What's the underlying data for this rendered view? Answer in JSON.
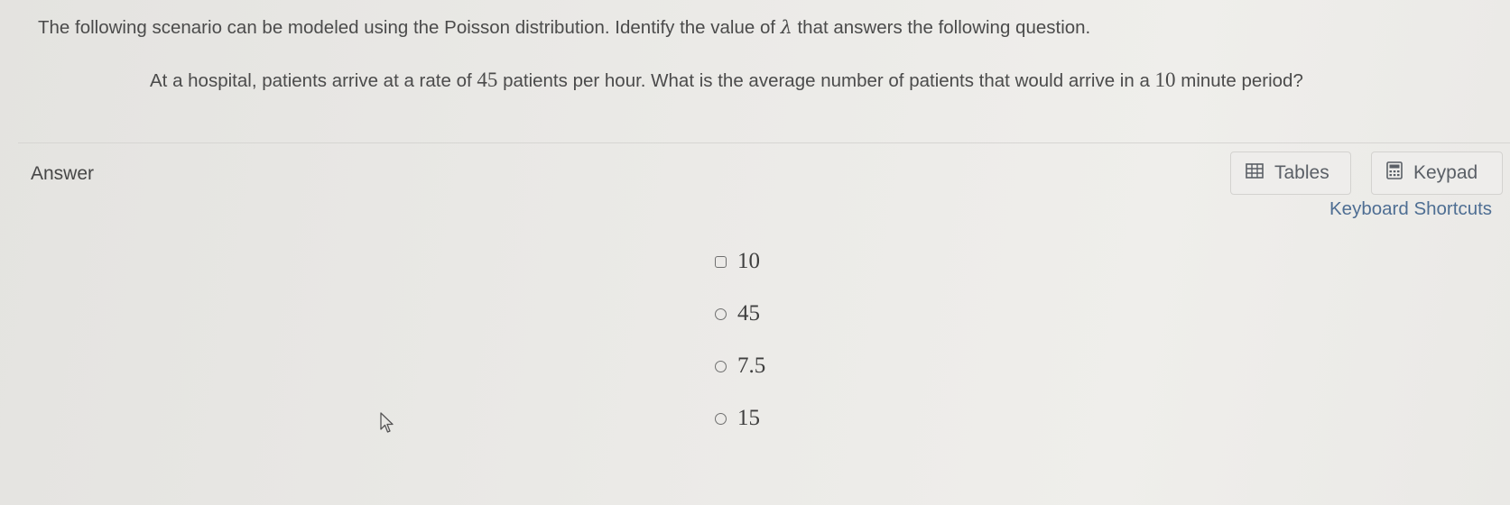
{
  "prompt": {
    "before_symbol": "The following scenario can be modeled using the Poisson distribution. Identify the value of ",
    "symbol": "λ",
    "after_symbol": " that answers the following question."
  },
  "question": {
    "part1": "At a hospital, patients arrive at a rate of ",
    "rate": "45",
    "part2": " patients per hour. What is the average number of patients that would arrive in a ",
    "period": "10",
    "part3": " minute period?"
  },
  "answer": {
    "label": "Answer",
    "tables_label": "Tables",
    "keypad_label": "Keypad",
    "shortcuts_label": "Keyboard Shortcuts",
    "options": [
      "10",
      "45",
      "7.5",
      "15"
    ]
  },
  "icons": {
    "tables": "table-grid-icon",
    "keypad": "calculator-icon",
    "cursor": "mouse-pointer-icon"
  }
}
